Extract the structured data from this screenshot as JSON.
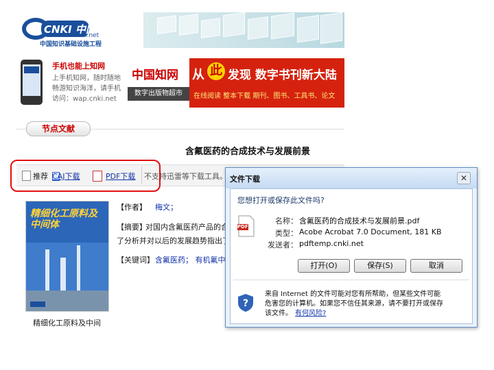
{
  "header": {
    "logo_text": "CNKI 中国知网",
    "logo_url_text": "www.cnki.net",
    "logo_subtitle": "中国知识基础设施工程"
  },
  "ads": {
    "phone_title": "手机也能上知网",
    "phone_line1": "上手机知网，随时随地",
    "phone_line2": "畅游知识海洋，请手机",
    "phone_line3": "访问：wap.cnki.net",
    "banner_brand": "中国知网",
    "banner_subbrand": "数字出版物超市",
    "banner_headline_a": "从",
    "banner_headline_circle": "此",
    "banner_headline_b": "发现  数字书刊新大陆",
    "banner_sub": "在线阅读  整本下载  期刊、图书、工具书、论文"
  },
  "section": {
    "tab_label": "节点文献"
  },
  "article": {
    "title": "含氟医药的合成技术与发展前景",
    "recommend_label": "推荐",
    "caj_label": "CAJ下载",
    "pdf_label": "PDF下载",
    "thunder_text": "不支持迅雷等下载工具。",
    "author_label": "【作者】",
    "author_value": "梅文；",
    "abstract_label": "【摘要】",
    "abstract_line1": "对国内含氟医药产品的合",
    "abstract_line2": "了分析并对以后的发展趋势指出了",
    "keywords_label": "【关键词】",
    "keywords_value": "含氟医药；  有机氟中间",
    "journal_caption": "精细化工原料及中间",
    "cover_title": "精细化工原料及中间体"
  },
  "dialog": {
    "title": "文件下载",
    "question": "您想打开或保存此文件吗?",
    "name_label": "名称：",
    "name_value": "含氟医药的合成技术与发展前景.pdf",
    "type_label": "类型：",
    "type_value": "Acobe Acrobat 7.0 Document, 181 KB",
    "from_label": "发送者：",
    "from_value": "pdftemp.cnki.net",
    "open_button": "打开(O)",
    "save_button": "保存(S)",
    "cancel_button": "取消",
    "warning_line1": "来自 Internet 的文件可能对您有所帮助，但某些文件可能",
    "warning_line2": "危害您的计算机。如果您不信任其来源，请不要打开或保存",
    "warning_line3": "该文件。",
    "risk_link": "有何风险?",
    "pdf_icon_text": "PDF"
  }
}
